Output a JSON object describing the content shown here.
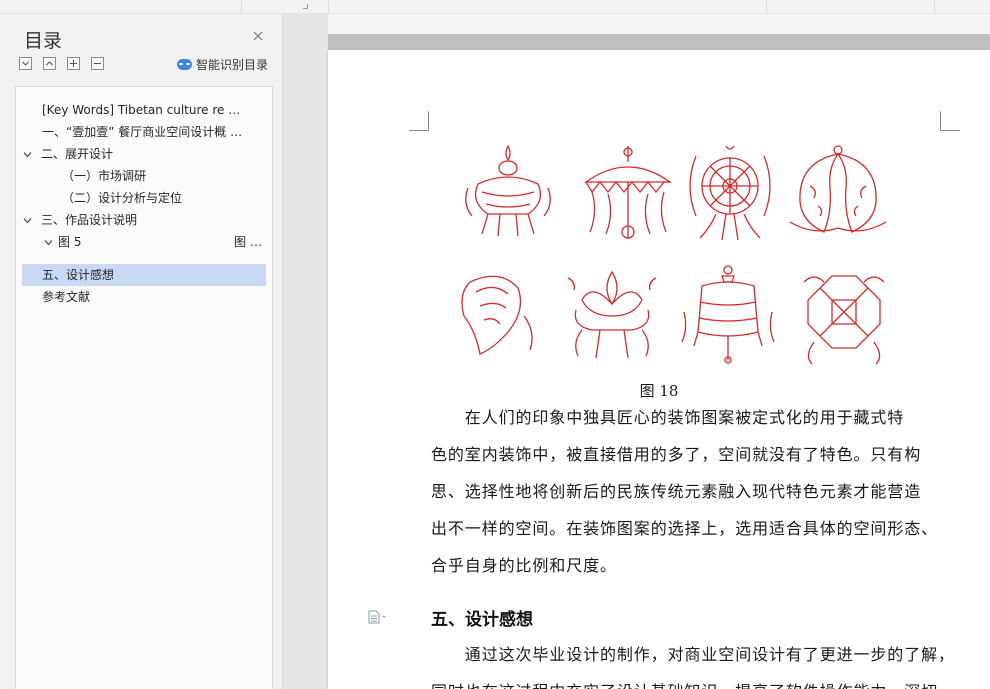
{
  "sidebar": {
    "title": "目录",
    "smart_toc_label": "智能识别目录",
    "toc": [
      {
        "text": "[Key Words]   Tibetan culture     re …",
        "level": 0,
        "chevron": "",
        "active": false
      },
      {
        "text": "一、“壹加壹” 餐厅商业空间设计概 …",
        "level": 0,
        "chevron": "",
        "active": false
      },
      {
        "text": "二、展开设计",
        "level": 0,
        "chevron": "down",
        "active": false
      },
      {
        "text": "（一）市场调研",
        "level": 1,
        "chevron": "",
        "active": false
      },
      {
        "text": "（二）设计分析与定位",
        "level": 1,
        "chevron": "",
        "active": false
      },
      {
        "text": "三、作品设计说明",
        "level": 0,
        "chevron": "down",
        "active": false
      },
      {
        "text": "图 5",
        "level": 1,
        "chevron": "down",
        "active": false,
        "page": "图 …"
      },
      {
        "text": "五、设计感想",
        "level": 0,
        "chevron": "",
        "active": true
      },
      {
        "text": "参考文献",
        "level": 0,
        "chevron": "",
        "active": false
      }
    ]
  },
  "document": {
    "caption": "图 18",
    "paragraph_lines": [
      "　　在人们的印象中独具匠心的装饰图案被定式化的用于藏式特",
      "色的室内装饰中，被直接借用的多了，空间就没有了特色。只有构",
      "思、选择性地将创新后的民族传统元素融入现代特色元素才能营造",
      "出不一样的空间。在装饰图案的选择上，选用适合具体的空间形态、",
      "合乎自身的比例和尺度。"
    ],
    "heading": "五、设计感想",
    "paragraph2_lines": [
      "　　通过这次毕业设计的制作，对商业空间设计有了更进一步的了解，",
      "同时也在这过程中充实了设计基础知识，提高了软件操作能力。深切"
    ],
    "accent_color": "#d42a2a"
  }
}
